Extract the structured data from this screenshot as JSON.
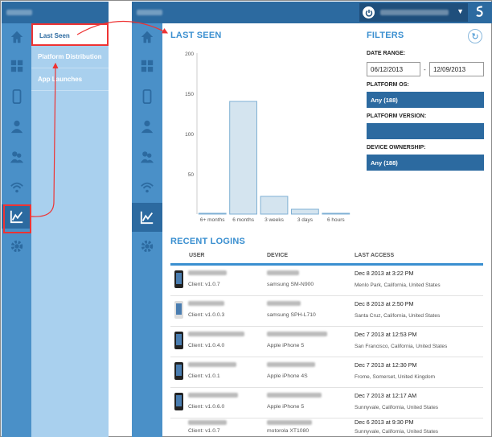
{
  "left_panel": {
    "submenu": [
      {
        "label": "Last Seen",
        "active": true
      },
      {
        "label": "Platform Distribution",
        "active": false
      },
      {
        "label": "App Launches",
        "active": false
      }
    ]
  },
  "rail_icons": [
    "home-icon",
    "grid-icon",
    "phone-icon",
    "user-icon",
    "users-icon",
    "wifi-icon",
    "chart-icon",
    "gear-icon"
  ],
  "colors": {
    "brand": "#2c6aa0",
    "rail": "#4a90c8",
    "accent": "#3a8fd0",
    "bar_fill": "#d4e4ef",
    "bar_stroke": "#7fb0d4",
    "annotation": "#e33333"
  },
  "last_seen": {
    "title": "LAST SEEN"
  },
  "chart_data": {
    "type": "bar",
    "title": "LAST SEEN",
    "categories": [
      "6+ months",
      "6 months",
      "3 weeks",
      "3 days",
      "6 hours"
    ],
    "values": [
      1,
      140,
      22,
      6,
      1
    ],
    "ylim": [
      0,
      200
    ],
    "yticks": [
      50,
      100,
      150,
      200
    ],
    "grid": false
  },
  "filters": {
    "title": "FILTERS",
    "date_range_label": "DATE RANGE:",
    "date_from": "06/12/2013",
    "date_sep": "-",
    "date_to": "12/09/2013",
    "platform_os_label": "PLATFORM OS:",
    "platform_os_value": "Any (188)",
    "platform_version_label": "PLATFORM VERSION:",
    "platform_version_value": "",
    "device_ownership_label": "DEVICE OWNERSHIP:",
    "device_ownership_value": "Any (188)"
  },
  "recent_logins": {
    "title": "RECENT LOGINS",
    "headers": {
      "user": "USER",
      "device": "DEVICE",
      "last_access": "LAST ACCESS"
    },
    "rows": [
      {
        "client": "Client: v1.0.7",
        "device": "samsung SM-N900",
        "date": "Dec 8 2013 at 3:22 PM",
        "location": "Menlo Park, California, United States"
      },
      {
        "client": "Client: v1.0.0.3",
        "device": "samsung SPH-L710",
        "date": "Dec 8 2013 at 2:50 PM",
        "location": "Santa Cruz, California, United States"
      },
      {
        "client": "Client: v1.0.4.0",
        "device": "Apple iPhone 5",
        "date": "Dec 7 2013 at 12:53 PM",
        "location": "San Francisco, California, United States"
      },
      {
        "client": "Client: v1.0.1",
        "device": "Apple iPhone 4S",
        "date": "Dec 7 2013 at 12:30 PM",
        "location": "Frome, Somerset, United Kingdom"
      },
      {
        "client": "Client: v1.0.6.0",
        "device": "Apple iPhone 5",
        "date": "Dec 7 2013 at 12:17 AM",
        "location": "Sunnyvale, California, United States"
      },
      {
        "client": "Client: v1.0.7",
        "device": "motorola XT1080",
        "date": "Dec 6 2013 at 9:30 PM",
        "location": "Sunnyvale, California, United States"
      }
    ]
  }
}
